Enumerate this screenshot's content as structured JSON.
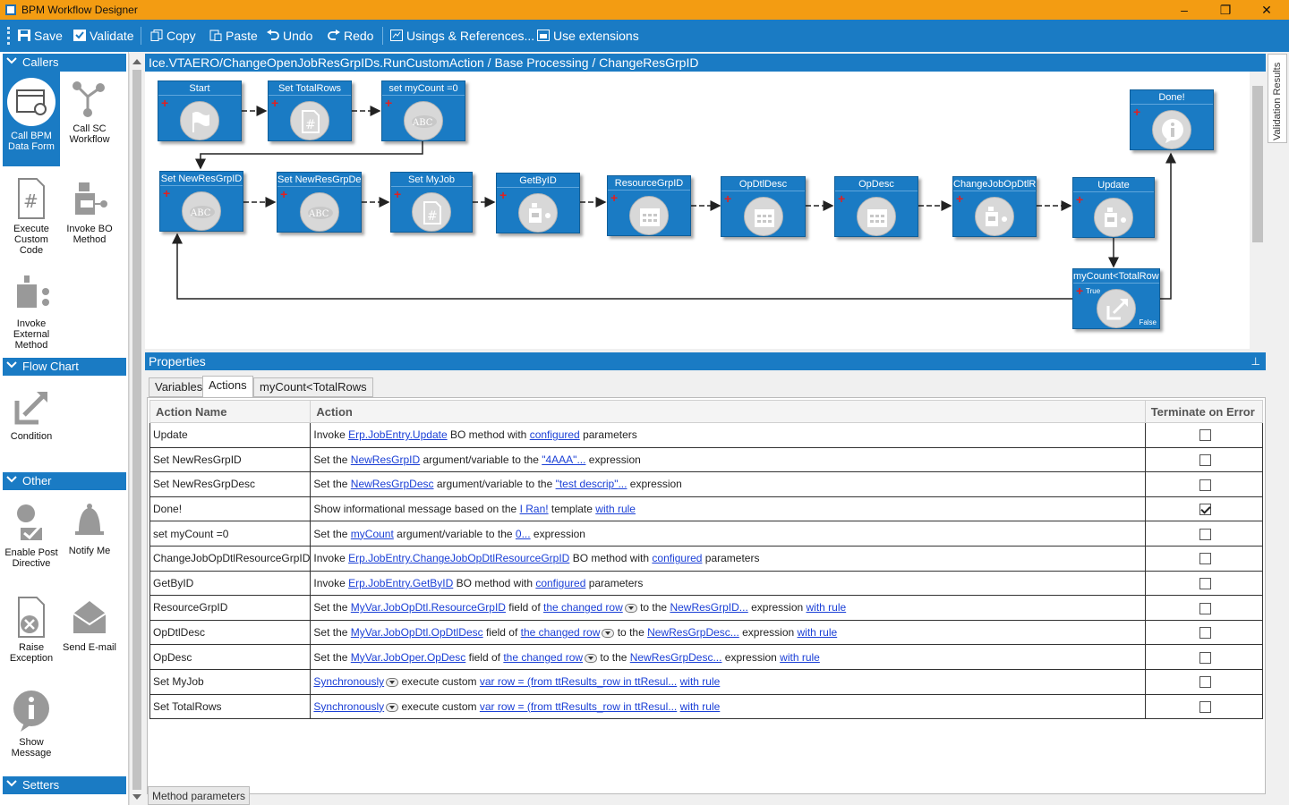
{
  "window": {
    "title": "BPM Workflow Designer",
    "minimize": "–",
    "maximize": "❐",
    "close": "✕"
  },
  "toolbar": {
    "save": "Save",
    "validate": "Validate",
    "copy": "Copy",
    "paste": "Paste",
    "undo": "Undo",
    "redo": "Redo",
    "usings": "Usings & References...",
    "extensions": "Use extensions"
  },
  "palette": {
    "callers": {
      "title": "Callers",
      "call_bpm": "Call BPM Data Form",
      "call_sc": "Call SC Workflow",
      "execute_custom": "Execute Custom Code",
      "invoke_bo": "Invoke BO Method",
      "invoke_external": "Invoke External Method"
    },
    "flow_chart": {
      "title": "Flow Chart",
      "condition": "Condition"
    },
    "other": {
      "title": "Other",
      "enable_post": "Enable Post Directive",
      "notify_me": "Notify Me",
      "raise_exception": "Raise Exception",
      "send_email": "Send E-mail",
      "show_message": "Show Message"
    },
    "setters": {
      "title": "Setters"
    }
  },
  "breadcrumb": "Ice.VTAERO/ChangeOpenJobResGrpIDs.RunCustomAction / Base Processing / ChangeResGrpID",
  "flow": {
    "start": "Start",
    "set_total_rows": "Set TotalRows",
    "set_mycount": "set myCount =0",
    "done": "Done!",
    "set_newresgrpid": "Set NewResGrpID",
    "set_newresgrpdesc": "Set NewResGrpDesc",
    "set_myjob": "Set MyJob",
    "getbyid": "GetByID",
    "resourcegrpid": "ResourceGrpID",
    "opdtldesc": "OpDtlDesc",
    "opdesc": "OpDesc",
    "changejob": "ChangeJobOpDtlResourceGrpID",
    "update": "Update",
    "condition": "myCount<TotalRows",
    "cond_true": "True",
    "cond_false": "False",
    "abc": "ABC"
  },
  "properties": {
    "title": "Properties",
    "pin": "📌",
    "tabs": {
      "variables": "Variables",
      "actions": "Actions",
      "condition": "myCount<TotalRows"
    },
    "columns": {
      "name": "Action Name",
      "action": "Action",
      "terminate": "Terminate on Error"
    },
    "rows": [
      {
        "name": "Update",
        "parts": [
          "Invoke ",
          "Erp.JobEntry.Update",
          " BO method with ",
          "configured",
          " parameters"
        ],
        "terminate": false
      },
      {
        "name": "Set NewResGrpID",
        "parts": [
          "Set the ",
          "NewResGrpID",
          " argument/variable to the ",
          "\"4AAA\"...",
          " expression"
        ],
        "terminate": false
      },
      {
        "name": "Set NewResGrpDesc",
        "parts": [
          "Set the ",
          "NewResGrpDesc",
          " argument/variable to the ",
          "\"test descrip\"...",
          " expression"
        ],
        "terminate": false
      },
      {
        "name": "Done!",
        "parts": [
          "Show informational message based on the ",
          "I Ran!",
          " template ",
          "with rule"
        ],
        "terminate": true
      },
      {
        "name": "set myCount =0",
        "parts": [
          "Set the ",
          "myCount",
          " argument/variable to the ",
          "0...",
          " expression"
        ],
        "terminate": false
      },
      {
        "name": "ChangeJobOpDtlResourceGrpID",
        "parts": [
          "Invoke ",
          "Erp.JobEntry.ChangeJobOpDtlResourceGrpID",
          " BO method with ",
          "configured",
          " parameters"
        ],
        "terminate": false
      },
      {
        "name": "GetByID",
        "parts": [
          "Invoke ",
          "Erp.JobEntry.GetByID",
          " BO method with ",
          "configured",
          " parameters"
        ],
        "terminate": false
      },
      {
        "name": "ResourceGrpID",
        "parts": [
          "Set the ",
          "MyVar.JobOpDtl.ResourceGrpID",
          " field of ",
          "the changed row",
          "▾",
          " to the ",
          "NewResGrpID...",
          " expression ",
          "with rule"
        ],
        "terminate": false
      },
      {
        "name": "OpDtlDesc",
        "parts": [
          "Set the ",
          "MyVar.JobOpDtl.OpDtlDesc",
          " field of ",
          "the changed row",
          "▾",
          " to the ",
          "NewResGrpDesc...",
          " expression ",
          "with rule"
        ],
        "terminate": false
      },
      {
        "name": "OpDesc",
        "parts": [
          "Set the ",
          "MyVar.JobOper.OpDesc",
          " field of ",
          "the changed row",
          "▾",
          " to the ",
          "NewResGrpDesc...",
          " expression ",
          "with rule"
        ],
        "terminate": false
      },
      {
        "name": "Set MyJob",
        "parts": [
          "Synchronously",
          "▾",
          " execute custom ",
          "var row = (from ttResults_row in ttResul...",
          " ",
          "with rule"
        ],
        "terminate": false
      },
      {
        "name": "Set TotalRows",
        "parts": [
          "Synchronously",
          "▾",
          " execute custom ",
          "var row = (from ttResults_row in ttResul...",
          " ",
          "with rule"
        ],
        "terminate": false
      }
    ],
    "method_parameters": "Method parameters"
  },
  "validation_results": "Validation Results",
  "colors": {
    "accent": "#1a7bc4",
    "titlebar": "#f39c12",
    "link": "#1a3fd6",
    "plus": "#e02020"
  }
}
